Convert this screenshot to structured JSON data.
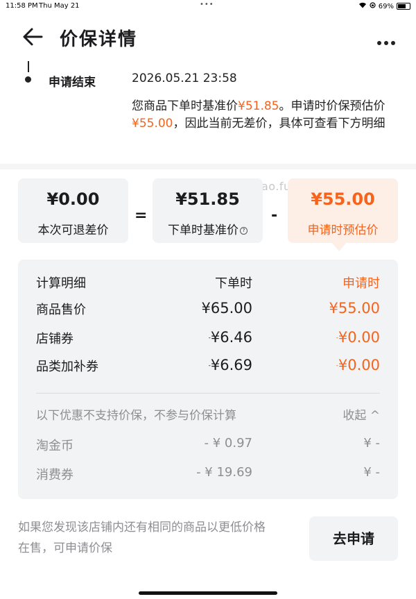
{
  "status_bar": {
    "time": "11:58 PM",
    "date": "Thu May 21",
    "battery": "69%",
    "battery_level": 0.69
  },
  "header": {
    "title": "价保详情"
  },
  "timeline": {
    "label": "申请结束",
    "time": "2026.05.21 23:58",
    "desc_part1": "您商品下单时基准价",
    "desc_price1": "¥51.85",
    "desc_part2": "。申请时价保预估价",
    "desc_price2": "¥55.00",
    "desc_part3": "，因此当前无差价，具体可查看下方明细"
  },
  "watermark": "线报酷-new.xianbao.fun",
  "summary": {
    "refund": {
      "value": "¥0.00",
      "label": "本次可退差价"
    },
    "equals": "=",
    "base": {
      "value": "¥51.85",
      "label": "下单时基准价"
    },
    "minus": "-",
    "estimate": {
      "value": "¥55.00",
      "label": "申请时预估价"
    }
  },
  "detail": {
    "headers": {
      "name": "计算明细",
      "order_time": "下单时",
      "apply_time": "申请时"
    },
    "rows": [
      {
        "name": "商品售价",
        "order": "¥65.00",
        "apply": "¥55.00"
      },
      {
        "name": "店铺券",
        "order_prefix": "-",
        "order": "¥6.46",
        "apply_prefix": "-",
        "apply": "¥0.00"
      },
      {
        "name": "品类加补券",
        "order_prefix": "-",
        "order": "¥6.69",
        "apply_prefix": "-",
        "apply": "¥0.00"
      }
    ],
    "unsupported_note": "以下优惠不支持价保，不参与价保计算",
    "collapse_label": "收起 ^",
    "unsupported_rows": [
      {
        "name": "淘金币",
        "order": "- ¥ 0.97",
        "apply": "¥ -"
      },
      {
        "name": "消费券",
        "order": "- ¥ 19.69",
        "apply": "¥ -"
      }
    ]
  },
  "footer": {
    "text": "如果您发现该店铺内还有相同的商品以更低价格在售，可申请价保",
    "button": "去申请"
  }
}
